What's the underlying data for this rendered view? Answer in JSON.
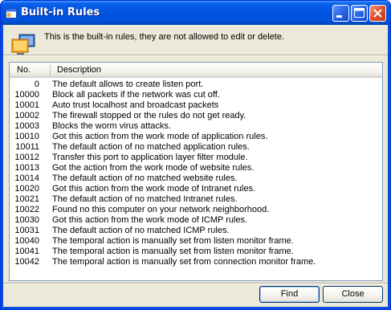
{
  "window": {
    "title": "Built-in Rules"
  },
  "info": {
    "message": "This is the built-in rules, they are not allowed to edit or delete."
  },
  "table": {
    "columns": {
      "no": "No.",
      "description": "Description"
    },
    "rows": [
      {
        "no": "0",
        "description": "The default allows to create listen port."
      },
      {
        "no": "10000",
        "description": "Block all packets if the network was cut off."
      },
      {
        "no": "10001",
        "description": "Auto trust localhost and broadcast packets"
      },
      {
        "no": "10002",
        "description": "The firewall stopped or the rules do not get ready."
      },
      {
        "no": "10003",
        "description": "Blocks the worm virus attacks."
      },
      {
        "no": "10010",
        "description": "Got this action from the work mode of application rules."
      },
      {
        "no": "10011",
        "description": "The default action of no matched application rules."
      },
      {
        "no": "10012",
        "description": "Transfer this port to application layer filter module."
      },
      {
        "no": "10013",
        "description": "Got the action from the work mode of website rules."
      },
      {
        "no": "10014",
        "description": "The default action of no matched website rules."
      },
      {
        "no": "10020",
        "description": "Got this action from the work mode of Intranet rules."
      },
      {
        "no": "10021",
        "description": "The default action of no matched Intranet rules."
      },
      {
        "no": "10022",
        "description": "Found no this computer on your network neighborhood."
      },
      {
        "no": "10030",
        "description": "Got this action from the work mode of ICMP rules."
      },
      {
        "no": "10031",
        "description": "The default action of no matched ICMP rules."
      },
      {
        "no": "10040",
        "description": "The temporal action is manually set from listen monitor frame."
      },
      {
        "no": "10041",
        "description": "The temporal action is manually set from listen monitor frame."
      },
      {
        "no": "10042",
        "description": "The temporal action is manually set from connection monitor frame."
      }
    ]
  },
  "buttons": {
    "find": "Find",
    "close": "Close"
  },
  "icons": {
    "app": "app-window-icon",
    "info": "monitor-icon",
    "minimize": "minimize-icon",
    "maximize": "maximize-icon",
    "close": "close-icon"
  }
}
